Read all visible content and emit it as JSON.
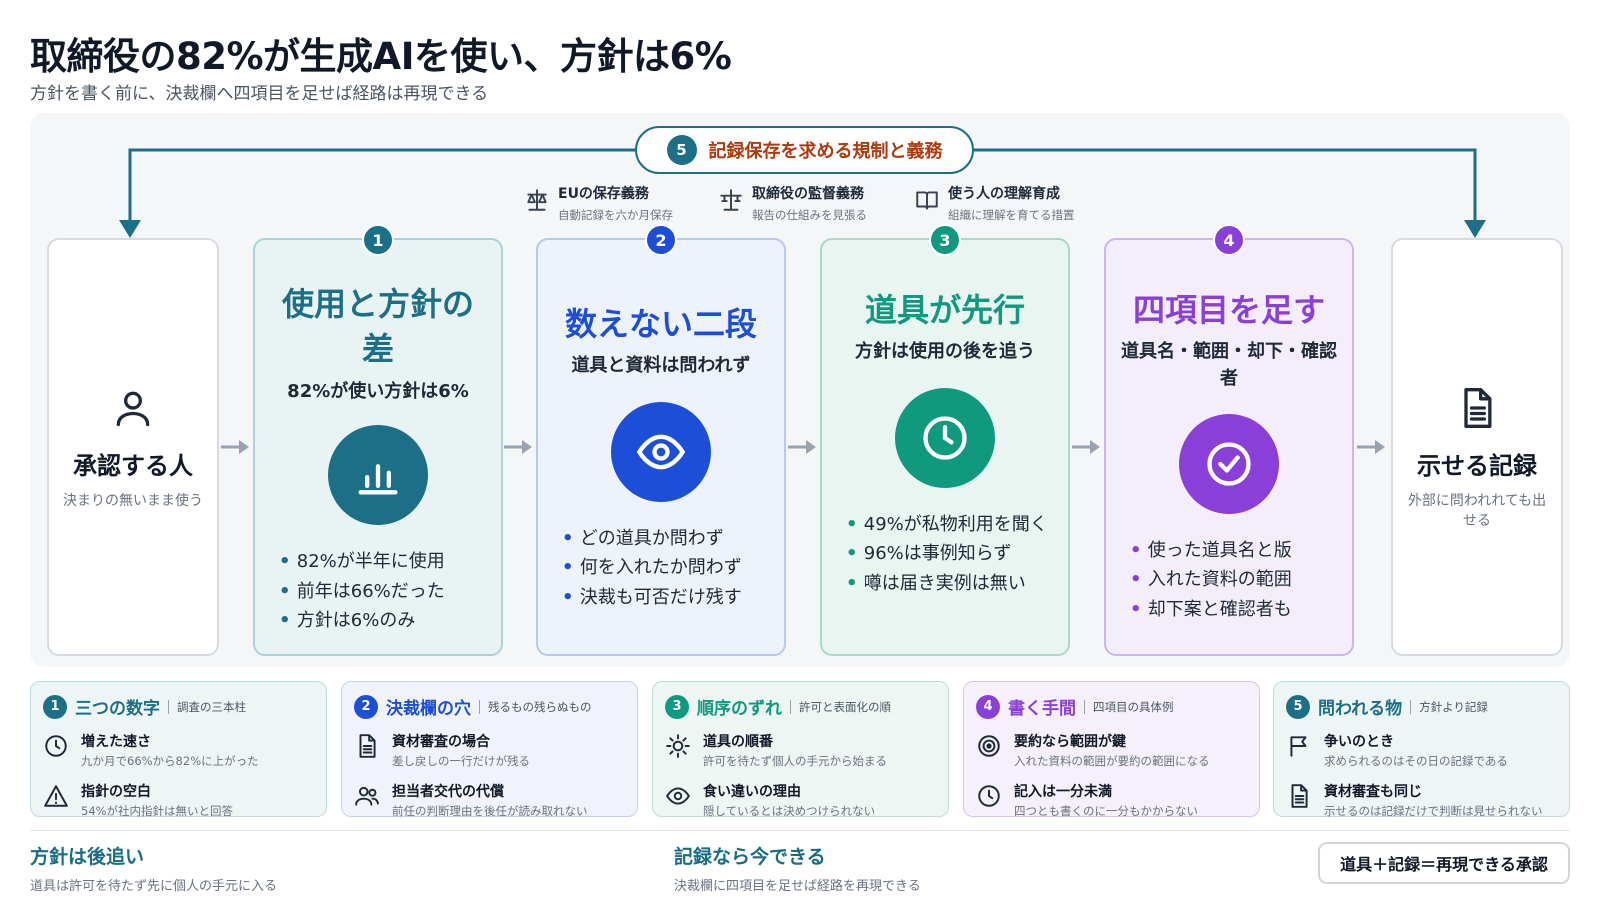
{
  "title": "取締役の82%が生成AIを使い、方針は6%",
  "subtitle": "方針を書く前に、決裁欄へ四項目を足せば経路は再現できる",
  "top_loop": {
    "num": "5",
    "label": "記録保存を求める規制と義務"
  },
  "obligations": [
    {
      "icon": "scales-icon",
      "title": "EUの保存義務",
      "sub": "自動記録を六か月保存"
    },
    {
      "icon": "balance-icon",
      "title": "取締役の監督義務",
      "sub": "報告の仕組みを見張る"
    },
    {
      "icon": "book-icon",
      "title": "使う人の理解育成",
      "sub": "組織に理解を育てる措置"
    }
  ],
  "start_node": {
    "icon": "person-icon",
    "title": "承認する人",
    "sub": "決まりの無いまま使う"
  },
  "end_node": {
    "icon": "document-icon",
    "title": "示せる記録",
    "sub": "外部に問われれても出せる"
  },
  "steps": [
    {
      "num": "1",
      "title": "使用と方針の差",
      "sub": "82%が使い方針は6%",
      "icon": "bar-chart-icon",
      "color": "#1b6f86",
      "bullets": [
        "82%が半年に使用",
        "前年は66%だった",
        "方針は6%のみ"
      ]
    },
    {
      "num": "2",
      "title": "数えない二段",
      "sub": "道具と資料は問われず",
      "icon": "eye-icon",
      "color": "#1d4ed8",
      "bullets": [
        "どの道具か問わず",
        "何を入れたか問わず",
        "決裁も可否だけ残す"
      ]
    },
    {
      "num": "3",
      "title": "道具が先行",
      "sub": "方針は使用の後を追う",
      "icon": "clock-icon",
      "color": "#0f9a7f",
      "bullets": [
        "49%が私物利用を聞く",
        "96%は事例知らず",
        "噂は届き実例は無い"
      ]
    },
    {
      "num": "4",
      "title": "四項目を足す",
      "sub": "道具名・範囲・却下・確認者",
      "icon": "check-circle-icon",
      "color": "#8b3fd9",
      "bullets": [
        "使った道具名と版",
        "入れた資料の範囲",
        "却下案と確認者も"
      ]
    }
  ],
  "bottom_cards": [
    {
      "num": "1",
      "title": "三つの数字",
      "tag": "調査の三本柱",
      "color": "#1b6f86",
      "rows": [
        {
          "icon": "clock-icon",
          "h": "増えた速さ",
          "s": "九か月で66%から82%に上がった"
        },
        {
          "icon": "warning-icon",
          "h": "指針の空白",
          "s": "54%が社内指針は無いと回答"
        }
      ]
    },
    {
      "num": "2",
      "title": "決裁欄の穴",
      "tag": "残るもの残らぬもの",
      "color": "#1d4ed8",
      "rows": [
        {
          "icon": "document-icon",
          "h": "資材審査の場合",
          "s": "差し戻しの一行だけが残る"
        },
        {
          "icon": "users-icon",
          "h": "担当者交代の代償",
          "s": "前任の判断理由を後任が読み取れない"
        }
      ]
    },
    {
      "num": "3",
      "title": "順序のずれ",
      "tag": "許可と表面化の順",
      "color": "#0f9a7f",
      "rows": [
        {
          "icon": "sun-icon",
          "h": "道具の順番",
          "s": "許可を待たず個人の手元から始まる"
        },
        {
          "icon": "eye-icon",
          "h": "食い違いの理由",
          "s": "隠しているとは決めつけられない"
        }
      ]
    },
    {
      "num": "4",
      "title": "書く手間",
      "tag": "四項目の具体例",
      "color": "#8b3fd9",
      "rows": [
        {
          "icon": "target-icon",
          "h": "要約なら範囲が鍵",
          "s": "入れた資料の範囲が要約の範囲になる"
        },
        {
          "icon": "clock-icon",
          "h": "記入は一分未満",
          "s": "四つとも書くのに一分もかからない"
        }
      ]
    },
    {
      "num": "5",
      "title": "問われる物",
      "tag": "方針より記録",
      "color": "#1b6f86",
      "rows": [
        {
          "icon": "flag-icon",
          "h": "争いのとき",
          "s": "求められるのはその日の記録である"
        },
        {
          "icon": "document-icon",
          "h": "資材審査も同じ",
          "s": "示せるのは記録だけで判断は見せられない"
        }
      ]
    }
  ],
  "footer": {
    "left_title": "方針は後追い",
    "left_sub": "道具は許可を待たず先に個人の手元に入る",
    "mid_title": "記録なら今できる",
    "mid_sub": "決裁欄に四項目を足せば経路を再現できる",
    "equation": "道具＋記録＝再現できる承認"
  }
}
